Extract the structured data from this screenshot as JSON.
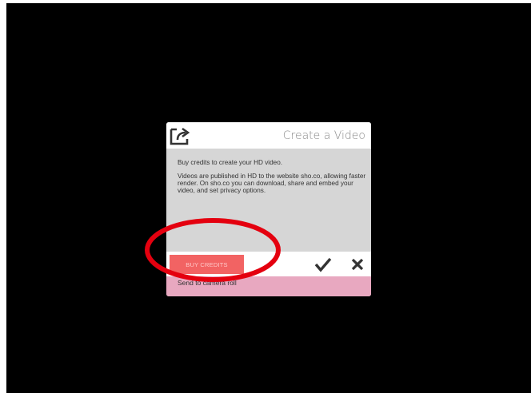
{
  "dialog": {
    "title": "Create a Video",
    "body": {
      "line1": "Buy credits to create your HD video.",
      "line2": "Videos are published in HD to the website sho.co, allowing faster render. On sho.co you can download, share and embed your video, and set privacy options."
    },
    "actions": {
      "buy_label": "BUY CREDITS",
      "confirm_icon": "checkmark-icon",
      "close_icon": "close-icon"
    },
    "camera_roll_label": "Send to camera roll"
  },
  "colors": {
    "screen_bg": "#000000",
    "buy_button": "#f26363",
    "camera_roll_bar": "#e8a8c0",
    "annotation": "#e4000f"
  }
}
